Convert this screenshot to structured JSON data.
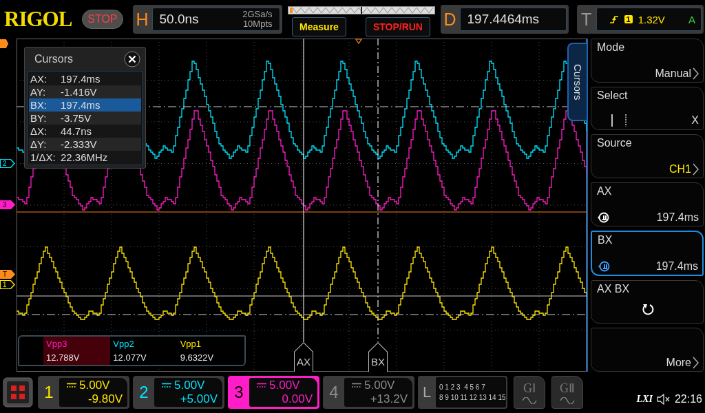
{
  "header": {
    "logo": "RIGOL",
    "run_state": "STOP",
    "horizontal": {
      "letter": "H",
      "scale": "50.0ns",
      "sample_rate": "2GSa/s",
      "memory_depth": "10Mpts"
    },
    "measure_button": "Measure",
    "stop_run_button": "STOP/RUN",
    "delay": {
      "letter": "D",
      "value": "197.4464ms"
    },
    "trigger": {
      "letter": "T",
      "source": "1",
      "level": "1.32V",
      "mode": "A"
    }
  },
  "cursors_panel": {
    "title": "Cursors",
    "rows": [
      {
        "label": "AX:",
        "value": "197.4ms",
        "selected": false
      },
      {
        "label": "AY:",
        "value": "-1.416V",
        "selected": false
      },
      {
        "label": "BX:",
        "value": "197.4ms",
        "selected": true
      },
      {
        "label": "BY:",
        "value": "-3.75V",
        "selected": false
      },
      {
        "label": "ΔX:",
        "value": "44.7ns",
        "selected": false
      },
      {
        "label": "ΔY:",
        "value": "-2.333V",
        "selected": false
      },
      {
        "label": "1/ΔX:",
        "value": "22.36MHz",
        "selected": false
      }
    ]
  },
  "plot": {
    "markers": [
      {
        "label": "2",
        "kind": "outline",
        "color": "#00e5ff"
      },
      {
        "label": "3",
        "kind": "filled",
        "color": "#ff1dc8"
      },
      {
        "label": "T",
        "kind": "filled",
        "color": "#ff8c1a"
      },
      {
        "label": "1",
        "kind": "outline",
        "color": "#ffe600"
      }
    ],
    "cursor_labels": [
      "AX",
      "BX"
    ]
  },
  "measurements": [
    {
      "name": "Vpp3",
      "value": "12.788V",
      "color": "#ff1dc8",
      "selected": true
    },
    {
      "name": "Vpp2",
      "value": "12.077V",
      "color": "#00e5ff",
      "selected": false
    },
    {
      "name": "Vpp1",
      "value": "9.6322V",
      "color": "#ffe600",
      "selected": false
    }
  ],
  "menu": {
    "tab": "Cursors",
    "items": [
      {
        "kind": "select",
        "label": "Mode",
        "value": "Manual",
        "selected": false
      },
      {
        "kind": "cursor_select",
        "label": "Select",
        "value": "X",
        "selected": false
      },
      {
        "kind": "select",
        "label": "Source",
        "value": "CH1",
        "color": "#ffe600",
        "selected": false
      },
      {
        "kind": "knob",
        "label": "AX",
        "value": "197.4ms",
        "selected": false
      },
      {
        "kind": "knob",
        "label": "BX",
        "value": "197.4ms",
        "selected": true
      },
      {
        "kind": "action",
        "label": "AX BX",
        "selected": false
      },
      {
        "kind": "more",
        "value": "More",
        "selected": false
      }
    ]
  },
  "channels": [
    {
      "number": "1",
      "scale": "5.00V",
      "offset": "-9.80V",
      "color": "#ffe600",
      "selected": false
    },
    {
      "number": "2",
      "scale": "5.00V",
      "offset": "+5.00V",
      "color": "#00e5ff",
      "selected": false
    },
    {
      "number": "3",
      "scale": "5.00V",
      "offset": "0.00V",
      "color": "#ff1dc8",
      "selected": true
    },
    {
      "number": "4",
      "scale": "5.00V",
      "offset": "+13.2V",
      "color": "#8c8c8c",
      "selected": false
    }
  ],
  "logic": {
    "letter": "L",
    "bits_low": "0 1 2 3  4 5 6 7",
    "bits_high": "8 9 10 11 12 13 14 15"
  },
  "generators": [
    {
      "label": "GⅠ"
    },
    {
      "label": "GⅡ"
    }
  ],
  "status": {
    "lxi": "LXI",
    "time": "22:16"
  }
}
